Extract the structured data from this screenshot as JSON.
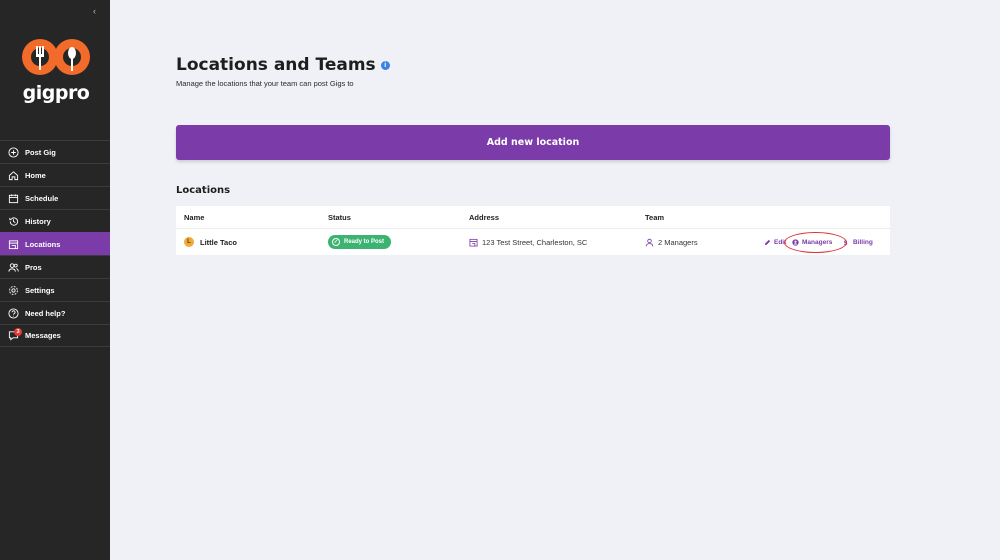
{
  "sidebar": {
    "collapse_label": "‹",
    "logo_text": "gigpro",
    "items": [
      {
        "label": "Post Gig",
        "icon": "plus-circle-icon"
      },
      {
        "label": "Home",
        "icon": "home-icon"
      },
      {
        "label": "Schedule",
        "icon": "calendar-icon"
      },
      {
        "label": "History",
        "icon": "history-icon"
      },
      {
        "label": "Locations",
        "icon": "store-icon",
        "active": true
      },
      {
        "label": "Pros",
        "icon": "users-icon"
      },
      {
        "label": "Settings",
        "icon": "gear-icon"
      },
      {
        "label": "Need help?",
        "icon": "help-icon"
      },
      {
        "label": "Messages",
        "icon": "chat-icon",
        "badge": "3"
      }
    ]
  },
  "header": {
    "title": "Locations and Teams",
    "info_icon": "i",
    "subtitle": "Manage the locations that your team can post Gigs to"
  },
  "add_button_label": "Add new location",
  "locations": {
    "section_title": "Locations",
    "columns": [
      "Name",
      "Status",
      "Address",
      "Team"
    ],
    "rows": [
      {
        "icon_letter": "L",
        "name": "Little Taco",
        "status": "Ready to Post",
        "address": "123 Test Street, Charleston, SC",
        "team": "2 Managers",
        "actions": {
          "edit": "Edit",
          "managers": "Managers",
          "billing": "Billing"
        }
      }
    ]
  },
  "colors": {
    "accent": "#7b3ba8",
    "sidebar": "#262626",
    "status_green": "#3cb371",
    "background": "#f0f1f7"
  }
}
